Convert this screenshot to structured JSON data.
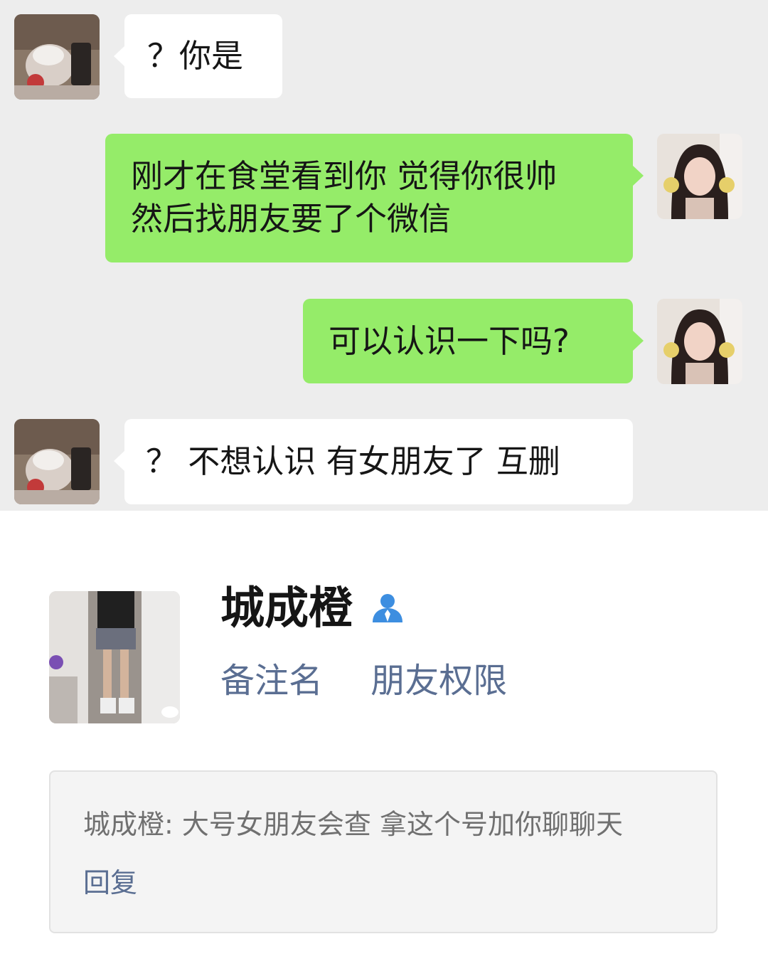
{
  "chat": {
    "messages": [
      {
        "from": "other",
        "lines": [
          "？你是"
        ]
      },
      {
        "from": "me",
        "lines": [
          "刚才在食堂看到你 觉得你很帅",
          "然后找朋友要了个微信"
        ]
      },
      {
        "from": "me",
        "lines": [
          "可以认识一下吗?"
        ]
      },
      {
        "from": "other",
        "lines": [
          "？ 不想认识 有女朋友了 互删"
        ]
      }
    ]
  },
  "profile": {
    "name": "城成橙",
    "name_icon": "person-icon",
    "actions": [
      "备注名",
      "朋友权限"
    ],
    "greeting": "城成橙: 大号女朋友会查 拿这个号加你聊聊天",
    "reply_label": "回复"
  },
  "colors": {
    "chat_background": "#ededed",
    "outgoing_bubble": "#95ec69",
    "incoming_bubble": "#ffffff",
    "link_blue": "#5a6e92",
    "icon_blue": "#3d8ee0"
  }
}
